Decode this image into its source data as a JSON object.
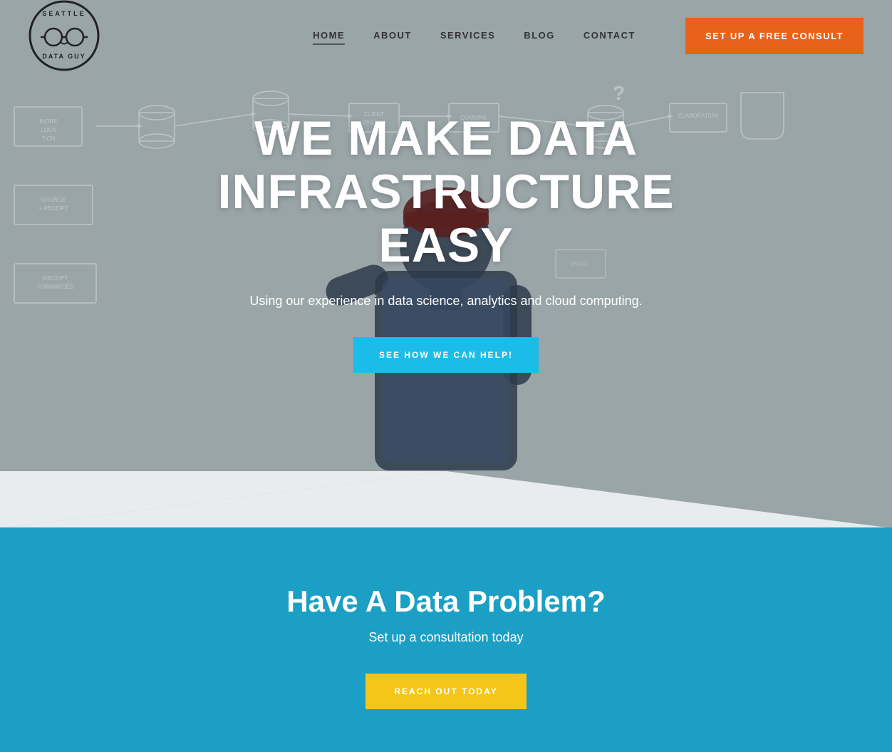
{
  "nav": {
    "logo_alt": "Seattle Data Guy",
    "links": [
      {
        "label": "HOME",
        "active": true,
        "id": "home"
      },
      {
        "label": "ABOUT",
        "active": false,
        "id": "about"
      },
      {
        "label": "SERVICES",
        "active": false,
        "id": "services"
      },
      {
        "label": "BLOG",
        "active": false,
        "id": "blog"
      },
      {
        "label": "CONTACT",
        "active": false,
        "id": "contact"
      }
    ],
    "cta_label": "SET UP A FREE CONSULT"
  },
  "hero": {
    "title_line1": "WE MAKE DATA INFRASTRUCTURE",
    "title_line2": "EASY",
    "subtitle": "Using our experience in data science, analytics and cloud computing.",
    "cta_label": "SEE HOW WE CAN HELP!"
  },
  "blue_section": {
    "heading": "Have A Data Problem?",
    "subtext": "Set up a consultation today",
    "cta_label": "REACH OUT TODAY"
  },
  "colors": {
    "hero_bg": "#8c9ea3",
    "hero_overlay": "rgba(120,140,148,0.7)",
    "nav_cta": "#e8621a",
    "hero_btn": "#1bbde8",
    "blue_section_bg": "#1b9fc4",
    "reach_btn": "#f5c518"
  }
}
